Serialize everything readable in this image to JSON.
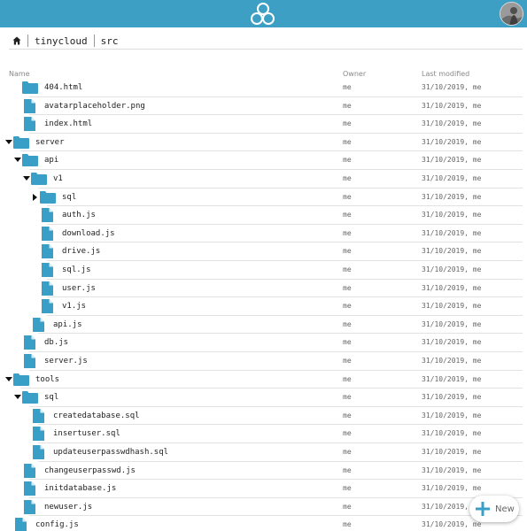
{
  "colors": {
    "accent": "#3e9fc5",
    "icon": "#3a9fc7",
    "text": "#222222",
    "muted": "#888888"
  },
  "header": {
    "logo_icon": "tinycloud-logo-icon",
    "avatar_icon": "user-avatar"
  },
  "breadcrumb": {
    "home_icon": "home-icon",
    "items": [
      "tinycloud",
      "src"
    ]
  },
  "columns": {
    "name": "Name",
    "owner": "Owner",
    "modified": "Last modified"
  },
  "files": [
    {
      "name": "404.html",
      "type": "folder",
      "level": 1,
      "owner": "me",
      "modified": "31/10/2019, me"
    },
    {
      "name": "avatarplaceholder.png",
      "type": "file",
      "level": 1,
      "owner": "me",
      "modified": "31/10/2019, me"
    },
    {
      "name": "index.html",
      "type": "file",
      "level": 1,
      "owner": "me",
      "modified": "31/10/2019, me"
    },
    {
      "name": "server",
      "type": "folder",
      "level": 0,
      "expanded": true,
      "owner": "me",
      "modified": "31/10/2019, me"
    },
    {
      "name": "api",
      "type": "folder",
      "level": 1,
      "expanded": true,
      "owner": "me",
      "modified": "31/10/2019, me"
    },
    {
      "name": "v1",
      "type": "folder",
      "level": 2,
      "expanded": true,
      "owner": "me",
      "modified": "31/10/2019, me"
    },
    {
      "name": "sql",
      "type": "folder",
      "level": 3,
      "expanded": false,
      "owner": "me",
      "modified": "31/10/2019, me"
    },
    {
      "name": "auth.js",
      "type": "file",
      "level": 3,
      "owner": "me",
      "modified": "31/10/2019, me"
    },
    {
      "name": "download.js",
      "type": "file",
      "level": 3,
      "owner": "me",
      "modified": "31/10/2019, me"
    },
    {
      "name": "drive.js",
      "type": "file",
      "level": 3,
      "owner": "me",
      "modified": "31/10/2019, me"
    },
    {
      "name": "sql.js",
      "type": "file",
      "level": 3,
      "owner": "me",
      "modified": "31/10/2019, me"
    },
    {
      "name": "user.js",
      "type": "file",
      "level": 3,
      "owner": "me",
      "modified": "31/10/2019, me"
    },
    {
      "name": "v1.js",
      "type": "file",
      "level": 3,
      "owner": "me",
      "modified": "31/10/2019, me"
    },
    {
      "name": "api.js",
      "type": "file",
      "level": 2,
      "owner": "me",
      "modified": "31/10/2019, me"
    },
    {
      "name": "db.js",
      "type": "file",
      "level": 1,
      "owner": "me",
      "modified": "31/10/2019, me"
    },
    {
      "name": "server.js",
      "type": "file",
      "level": 1,
      "owner": "me",
      "modified": "31/10/2019, me"
    },
    {
      "name": "tools",
      "type": "folder",
      "level": 0,
      "expanded": true,
      "owner": "me",
      "modified": "31/10/2019, me"
    },
    {
      "name": "sql",
      "type": "folder",
      "level": 1,
      "expanded": true,
      "owner": "me",
      "modified": "31/10/2019, me"
    },
    {
      "name": "createdatabase.sql",
      "type": "file",
      "level": 2,
      "owner": "me",
      "modified": "31/10/2019, me"
    },
    {
      "name": "insertuser.sql",
      "type": "file",
      "level": 2,
      "owner": "me",
      "modified": "31/10/2019, me"
    },
    {
      "name": "updateuserpasswdhash.sql",
      "type": "file",
      "level": 2,
      "owner": "me",
      "modified": "31/10/2019, me"
    },
    {
      "name": "changeuserpasswd.js",
      "type": "file",
      "level": 1,
      "owner": "me",
      "modified": "31/10/2019, me"
    },
    {
      "name": "initdatabase.js",
      "type": "file",
      "level": 1,
      "owner": "me",
      "modified": "31/10/2019, me"
    },
    {
      "name": "newuser.js",
      "type": "file",
      "level": 1,
      "owner": "me",
      "modified": "31/10/2019, me"
    },
    {
      "name": "config.js",
      "type": "file",
      "level": 0,
      "owner": "me",
      "modified": "31/10/2019, me"
    }
  ],
  "fab": {
    "label": "New",
    "icon": "plus-icon"
  }
}
